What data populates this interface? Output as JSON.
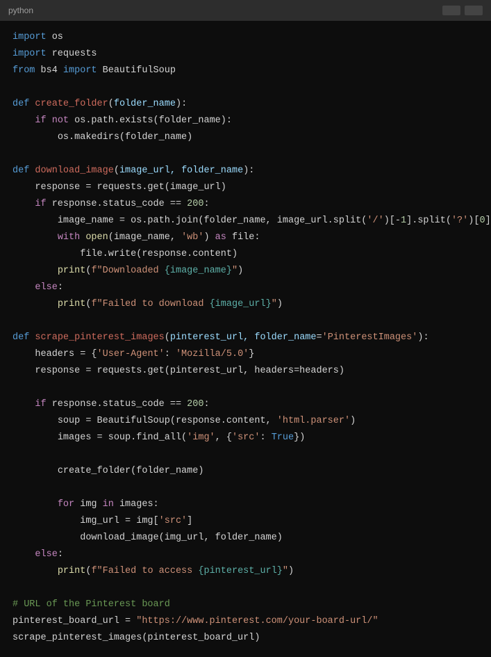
{
  "header": {
    "language": "python"
  },
  "code": {
    "l1_import": "import",
    "l1_os": " os",
    "l2_import": "import",
    "l2_requests": " requests",
    "l3_from": "from",
    "l3_bs4": " bs4 ",
    "l3_import": "import",
    "l3_beautifulsoup": " BeautifulSoup",
    "l5_def": "def",
    "l5_fname": " create_folder",
    "l5_paren1": "(",
    "l5_param": "folder_name",
    "l5_paren2": "):",
    "l6_indent": "    ",
    "l6_if": "if",
    "l6_space": " ",
    "l6_not": "not",
    "l6_expr": " os.path.exists(folder_name):",
    "l7_indent": "        ",
    "l7_expr": "os.makedirs(folder_name)",
    "l9_def": "def",
    "l9_fname": " download_image",
    "l9_paren1": "(",
    "l9_params": "image_url, folder_name",
    "l9_paren2": "):",
    "l10_indent": "    ",
    "l10_expr": "response = requests.get(image_url)",
    "l11_indent": "    ",
    "l11_if": "if",
    "l11_expr1": " response.status_code == ",
    "l11_num": "200",
    "l11_colon": ":",
    "l12_indent": "        ",
    "l12_expr1": "image_name = os.path.join(folder_name, image_url.split(",
    "l12_str1": "'/'",
    "l12_expr2": ")[-",
    "l12_num1": "1",
    "l12_expr3": "].split(",
    "l12_str2": "'?'",
    "l12_expr4": ")[",
    "l12_num2": "0",
    "l12_expr5": "])",
    "l13_indent": "        ",
    "l13_with": "with",
    "l13_space": " ",
    "l13_open": "open",
    "l13_expr1": "(image_name, ",
    "l13_str": "'wb'",
    "l13_expr2": ") ",
    "l13_as": "as",
    "l13_expr3": " file:",
    "l14_indent": "            ",
    "l14_expr": "file.write(response.content)",
    "l15_indent": "        ",
    "l15_print": "print",
    "l15_paren1": "(",
    "l15_f": "f\"Downloaded ",
    "l15_brace1": "{image_name}",
    "l15_quote": "\"",
    "l15_paren2": ")",
    "l16_indent": "    ",
    "l16_else": "else",
    "l16_colon": ":",
    "l17_indent": "        ",
    "l17_print": "print",
    "l17_paren1": "(",
    "l17_f": "f\"Failed to download ",
    "l17_brace": "{image_url}",
    "l17_quote": "\"",
    "l17_paren2": ")",
    "l19_def": "def",
    "l19_fname": " scrape_pinterest_images",
    "l19_paren1": "(",
    "l19_param1": "pinterest_url, folder_name",
    "l19_eq": "=",
    "l19_str": "'PinterestImages'",
    "l19_paren2": "):",
    "l20_indent": "    ",
    "l20_expr1": "headers = {",
    "l20_str1": "'User-Agent'",
    "l20_expr2": ": ",
    "l20_str2": "'Mozilla/5.0'",
    "l20_expr3": "}",
    "l21_indent": "    ",
    "l21_expr": "response = requests.get(pinterest_url, headers=headers)",
    "l23_indent": "    ",
    "l23_if": "if",
    "l23_expr1": " response.status_code == ",
    "l23_num": "200",
    "l23_colon": ":",
    "l24_indent": "        ",
    "l24_expr1": "soup = BeautifulSoup(response.content, ",
    "l24_str": "'html.parser'",
    "l24_expr2": ")",
    "l25_indent": "        ",
    "l25_expr1": "images = soup.find_all(",
    "l25_str1": "'img'",
    "l25_expr2": ", {",
    "l25_str2": "'src'",
    "l25_expr3": ": ",
    "l25_true": "True",
    "l25_expr4": "})",
    "l27_indent": "        ",
    "l27_expr": "create_folder(folder_name)",
    "l29_indent": "        ",
    "l29_for": "for",
    "l29_expr1": " img ",
    "l29_in": "in",
    "l29_expr2": " images:",
    "l30_indent": "            ",
    "l30_expr1": "img_url = img[",
    "l30_str": "'src'",
    "l30_expr2": "]",
    "l31_indent": "            ",
    "l31_expr": "download_image(img_url, folder_name)",
    "l32_indent": "    ",
    "l32_else": "else",
    "l32_colon": ":",
    "l33_indent": "        ",
    "l33_print": "print",
    "l33_paren1": "(",
    "l33_f": "f\"Failed to access ",
    "l33_brace": "{pinterest_url}",
    "l33_quote": "\"",
    "l33_paren2": ")",
    "l35_comment": "# URL of the Pinterest board",
    "l36_expr1": "pinterest_board_url = ",
    "l36_str": "\"https://www.pinterest.com/your-board-url/\"",
    "l37_expr": "scrape_pinterest_images(pinterest_board_url)"
  }
}
